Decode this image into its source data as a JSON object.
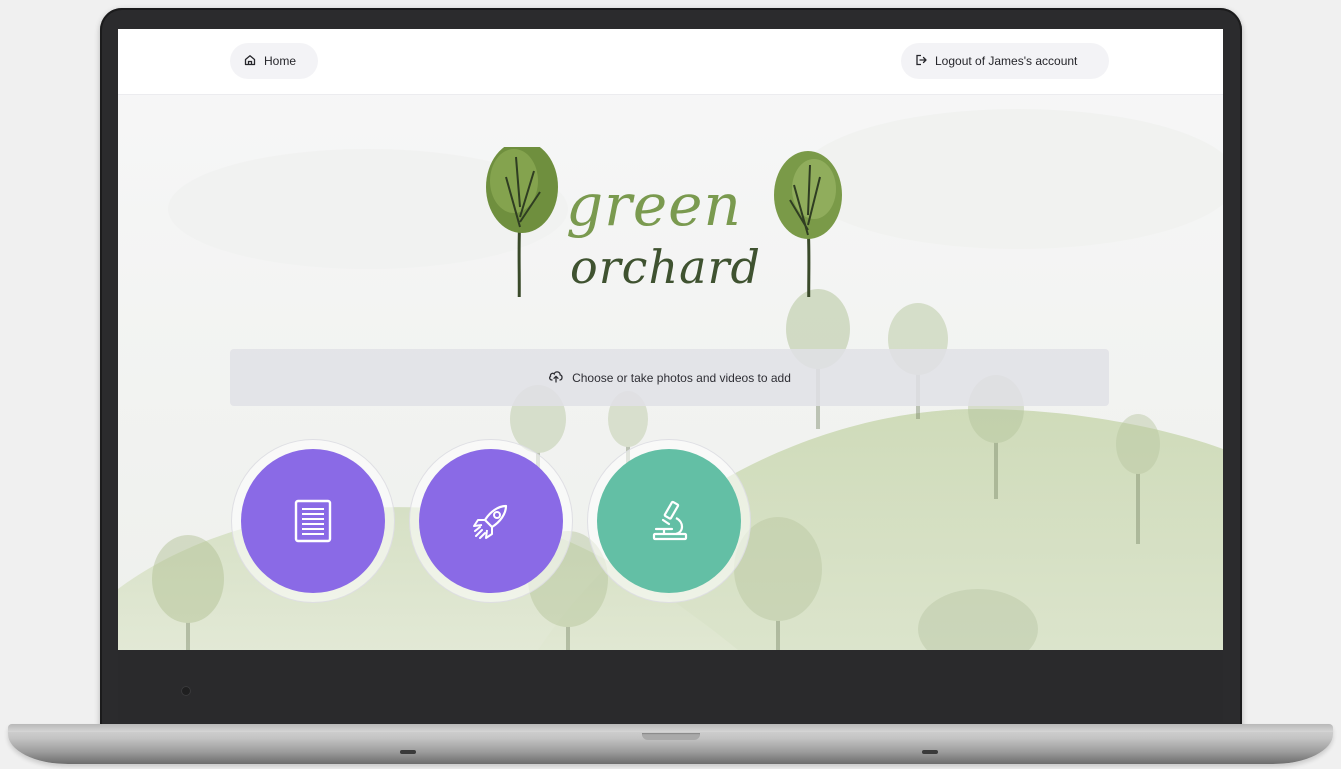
{
  "nav": {
    "home_label": "Home",
    "logout_label": "Logout of James's account"
  },
  "logo": {
    "line1": "green",
    "line2": "orchard"
  },
  "upload": {
    "label": "Choose or take photos and videos to add"
  },
  "actions": [
    {
      "icon": "document-icon",
      "color": "#8a6ae6"
    },
    {
      "icon": "rocket-icon",
      "color": "#8a6ae6"
    },
    {
      "icon": "microscope-icon",
      "color": "#63bfa5"
    }
  ],
  "colors": {
    "purple": "#8a6ae6",
    "teal": "#63bfa5",
    "logo_light_green": "#7a9a4f",
    "logo_dark_green": "#3f5230"
  }
}
